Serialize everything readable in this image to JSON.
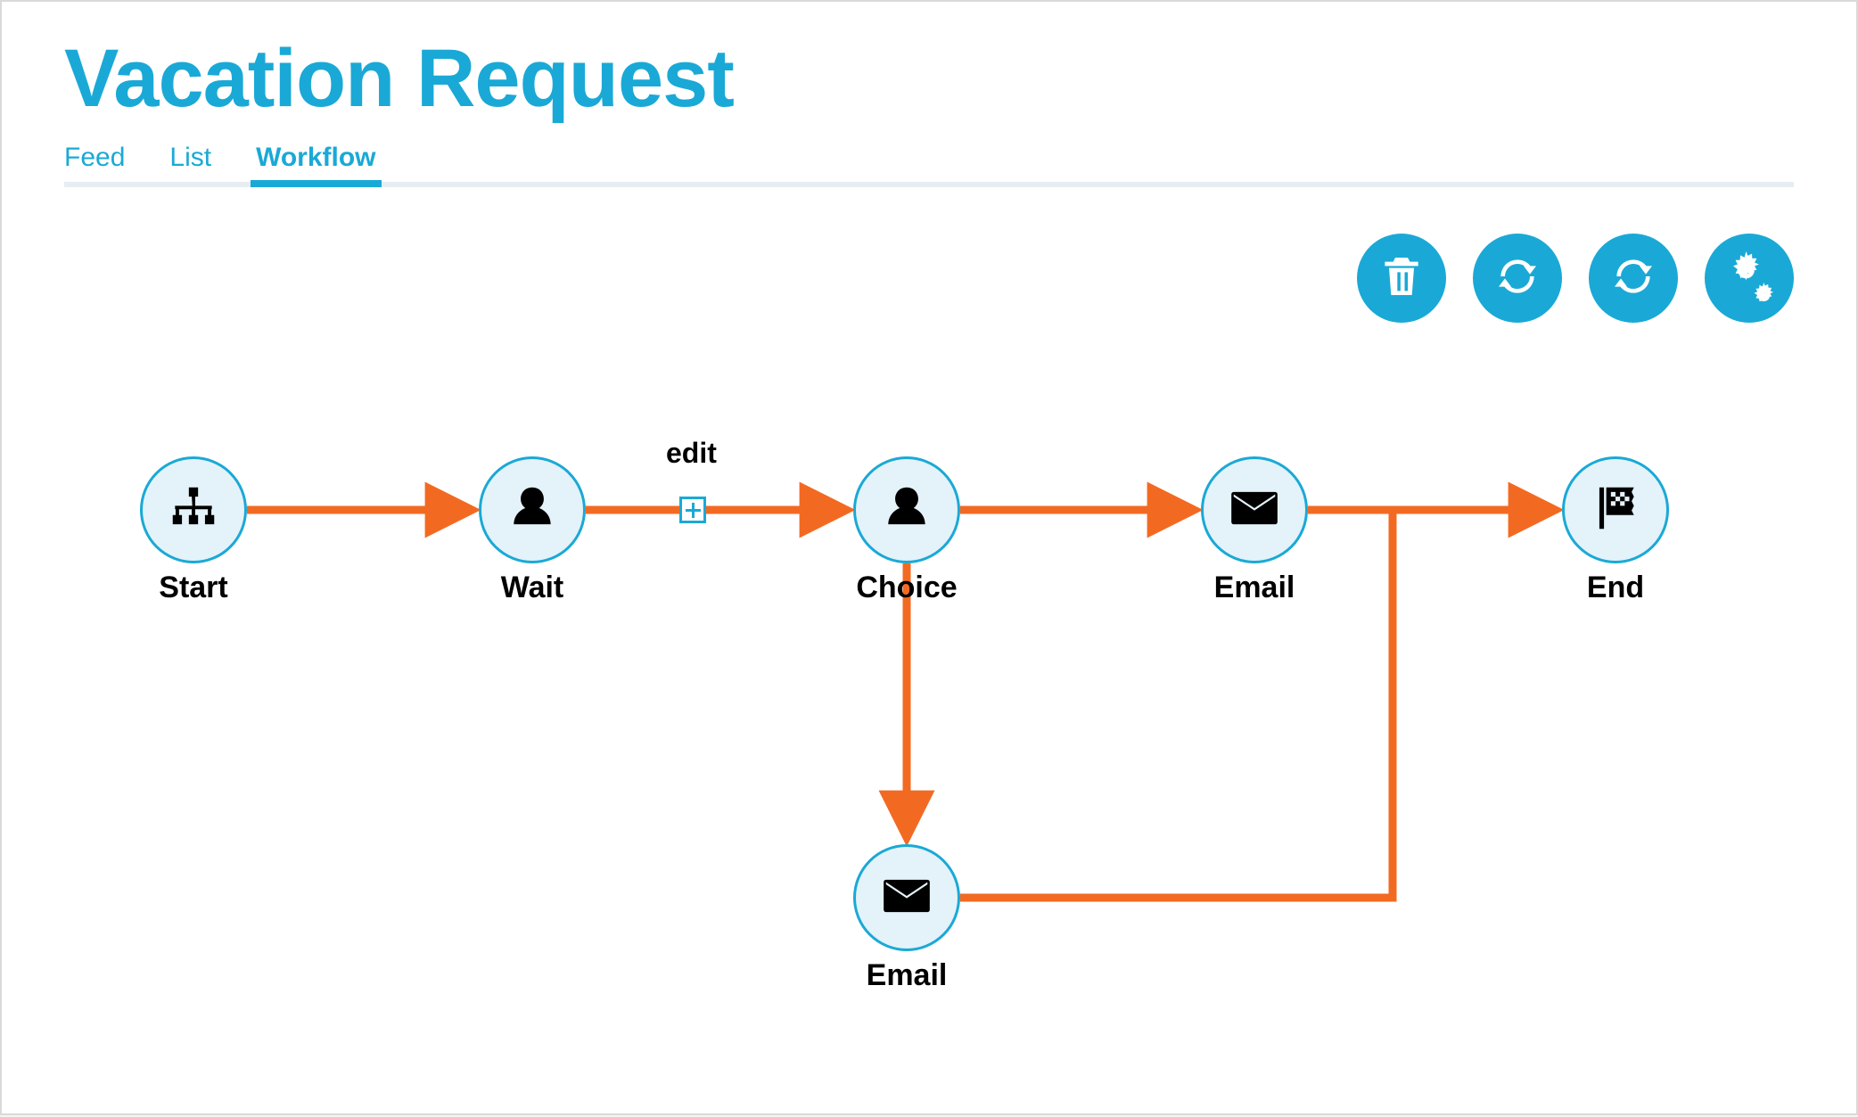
{
  "header": {
    "title": "Vacation Request"
  },
  "tabs": [
    {
      "label": "Feed",
      "active": false
    },
    {
      "label": "List",
      "active": false
    },
    {
      "label": "Workflow",
      "active": true
    }
  ],
  "toolbar": {
    "delete_name": "delete-button",
    "refresh1_name": "refresh-button",
    "refresh2_name": "refresh-alt-button",
    "settings_name": "settings-button"
  },
  "workflow": {
    "edge_label": "edit",
    "nodes": {
      "start": {
        "label": "Start"
      },
      "wait": {
        "label": "Wait"
      },
      "choice": {
        "label": "Choice"
      },
      "email1": {
        "label": "Email"
      },
      "end": {
        "label": "End"
      },
      "email2": {
        "label": "Email"
      }
    }
  },
  "colors": {
    "brand": "#1aa9d6",
    "edge": "#f26a21",
    "node_fill": "#e4f2f9"
  }
}
